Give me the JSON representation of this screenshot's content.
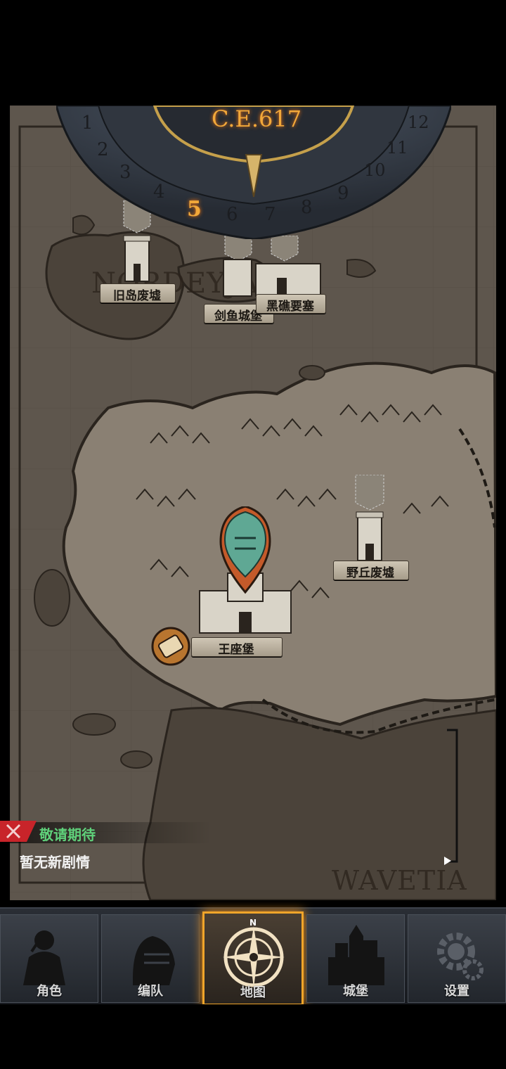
{
  "calendar": {
    "year": "C.E.617",
    "months": [
      "1",
      "2",
      "3",
      "4",
      "5",
      "6",
      "7",
      "8",
      "9",
      "10",
      "11",
      "12"
    ],
    "current_month": "5"
  },
  "map": {
    "regions": {
      "north": "NORDEYJA",
      "south": "WAVETIA"
    },
    "locations": [
      {
        "name": "旧岛废墟"
      },
      {
        "name": "剑鱼城堡"
      },
      {
        "name": "黑礁要塞"
      },
      {
        "name": "野丘废墟"
      },
      {
        "name": "王座堡"
      }
    ]
  },
  "story": {
    "title": "敬请期待",
    "subtitle": "暂无新剧情"
  },
  "nav": {
    "items": [
      {
        "label": "角色",
        "icon": "knight-icon"
      },
      {
        "label": "编队",
        "icon": "helmet-icon"
      },
      {
        "label": "地图",
        "icon": "compass-icon",
        "active": true
      },
      {
        "label": "城堡",
        "icon": "castle-icon"
      },
      {
        "label": "设置",
        "icon": "gear-icon"
      }
    ],
    "compass_letter": "N"
  },
  "colors": {
    "accent": "#f0a52a",
    "story_title": "#5fd07a",
    "map_land": "#8a8073",
    "map_sea": "#5a5249"
  }
}
